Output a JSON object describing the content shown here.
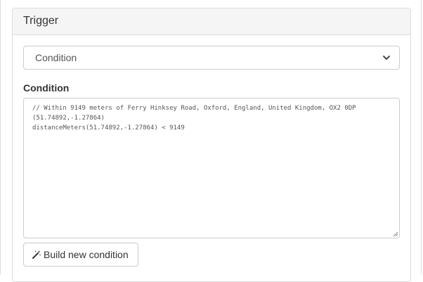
{
  "panel": {
    "title": "Trigger"
  },
  "trigger_type": {
    "selected": "Condition"
  },
  "condition": {
    "label": "Condition",
    "code": "// Within 9149 meters of Ferry Hinksey Road, Oxford, England, United Kingdom, OX2 0DP\n(51.74892,-1.27864)\ndistanceMeters(51.74892,-1.27864) < 9149"
  },
  "build_button": {
    "label": "Build new condition",
    "icon": "magic-wand-icon"
  }
}
